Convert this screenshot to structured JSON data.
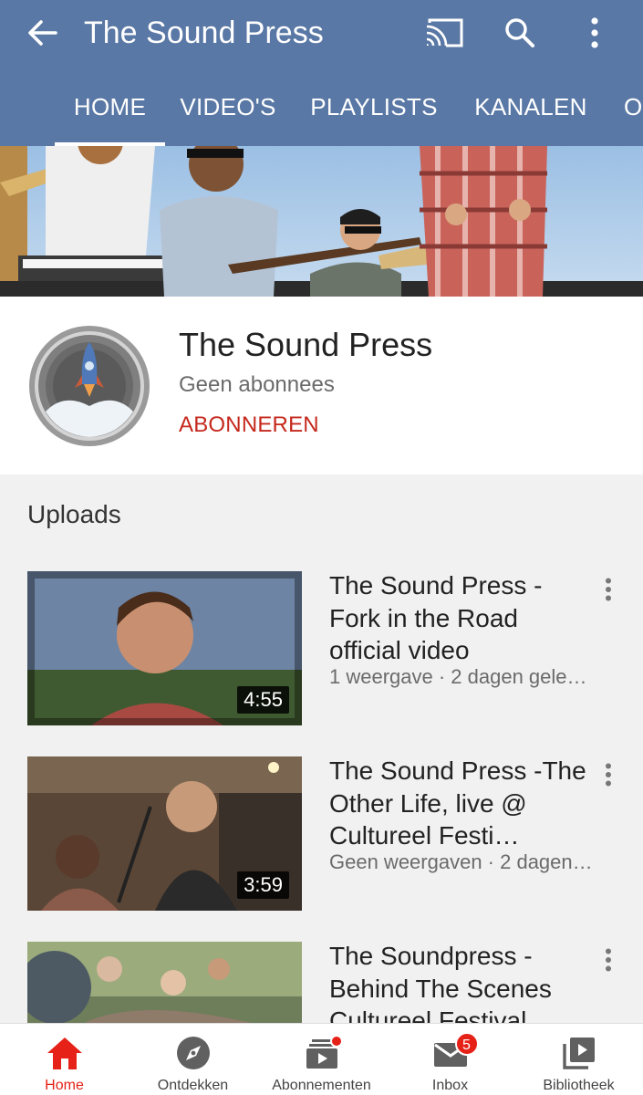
{
  "appbar": {
    "title": "The Sound Press",
    "back_icon": "arrow-back-icon",
    "cast_icon": "cast-icon",
    "search_icon": "search-icon",
    "more_icon": "more-vert-icon",
    "background_color": "#5a78a5"
  },
  "tabs": [
    {
      "label": "HOME",
      "active": true
    },
    {
      "label": "VIDEO'S",
      "active": false
    },
    {
      "label": "PLAYLISTS",
      "active": false
    },
    {
      "label": "KANALEN",
      "active": false
    },
    {
      "label": "O",
      "active": false
    }
  ],
  "channel": {
    "name": "The Sound Press",
    "subscribers": "Geen abonnees",
    "subscribe_label": "ABONNEREN",
    "accent_color": "#c5281c"
  },
  "uploads": {
    "title": "Uploads",
    "videos": [
      {
        "title": "The Sound Press - Fork in the Road official video",
        "meta": "1 weergave · 2 dagen geleden",
        "duration": "4:55"
      },
      {
        "title": "The Sound Press -The Other Life, live @ Cultureel Festi…",
        "meta": "Geen weergaven · 2 dagen geleden",
        "duration": "3:59"
      },
      {
        "title": "The Soundpress - Behind The Scenes Cultureel Festival",
        "meta": "",
        "duration": ""
      }
    ]
  },
  "bottom_nav": {
    "items": [
      {
        "label": "Home",
        "icon": "home-icon",
        "active": true
      },
      {
        "label": "Ontdekken",
        "icon": "explore-compass-icon",
        "active": false
      },
      {
        "label": "Abonnementen",
        "icon": "subscriptions-icon",
        "active": false,
        "dot": true
      },
      {
        "label": "Inbox",
        "icon": "inbox-mail-icon",
        "active": false,
        "badge": "5"
      },
      {
        "label": "Bibliotheek",
        "icon": "library-icon",
        "active": false
      }
    ],
    "active_color": "#e62117"
  }
}
